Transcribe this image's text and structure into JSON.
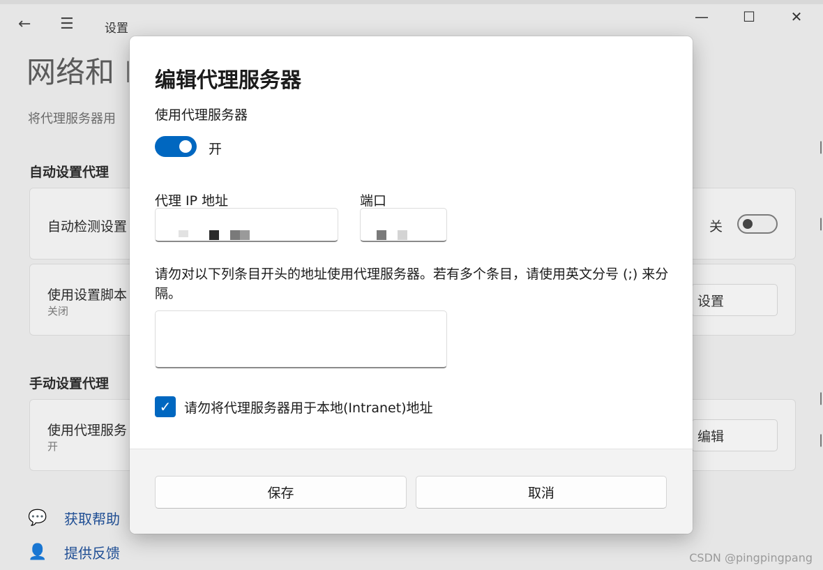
{
  "window": {
    "app_title": "设置",
    "page_title": "网络和 I",
    "page_description": "将代理服务器用",
    "back_icon": "back-arrow-icon",
    "menu_icon": "hamburger-menu-icon",
    "minimize_icon": "minimize-icon",
    "maximize_icon": "maximize-icon",
    "close_icon": "close-icon"
  },
  "auto_section": {
    "heading": "自动设置代理",
    "detect": {
      "title": "自动检测设置",
      "toggle_state": "关"
    },
    "script": {
      "title": "使用设置脚本",
      "subtitle": "关闭",
      "button": "设置"
    }
  },
  "manual_section": {
    "heading": "手动设置代理",
    "proxy": {
      "title": "使用代理服务",
      "subtitle": "开",
      "button": "编辑"
    }
  },
  "help_links": {
    "get_help": "获取帮助",
    "feedback": "提供反馈"
  },
  "watermark": "CSDN @pingpingpang",
  "dialog": {
    "title": "编辑代理服务器",
    "use_proxy_label": "使用代理服务器",
    "toggle_state": "开",
    "ip_label": "代理 IP 地址",
    "port_label": "端口",
    "ip_value": "",
    "port_value": "",
    "exceptions_note": "请勿对以下列条目开头的地址使用代理服务器。若有多个条目，请使用英文分号 (;) 来分隔。",
    "exceptions_value": "",
    "local_checkbox_label": "请勿将代理服务器用于本地(Intranet)地址",
    "local_checkbox_checked": true,
    "save_button": "保存",
    "cancel_button": "取消",
    "accent_color": "#0067c0"
  }
}
